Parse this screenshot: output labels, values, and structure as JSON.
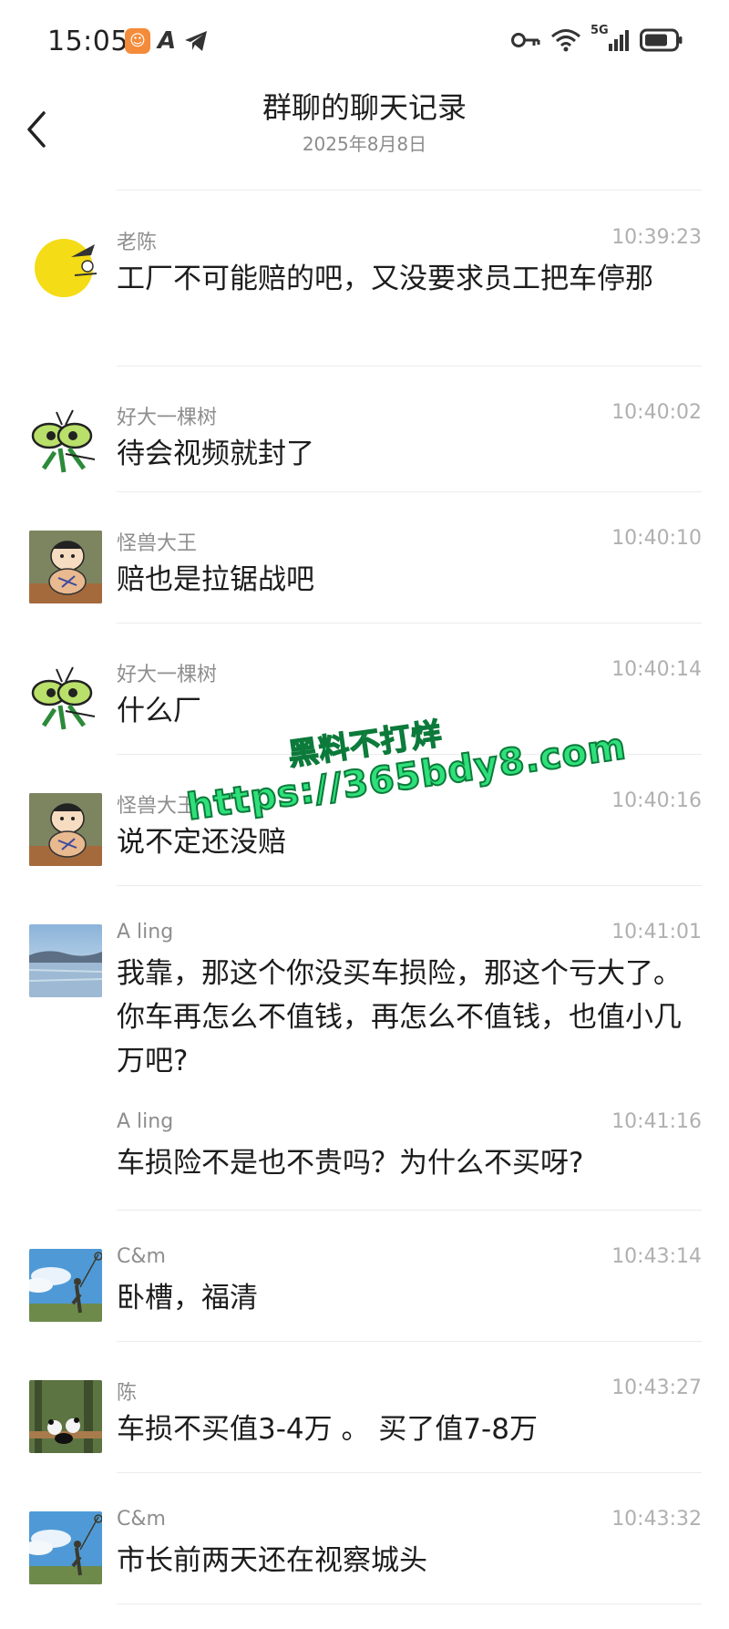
{
  "status_bar": {
    "time": "15:05",
    "network": "5G",
    "icons": [
      "app-badge-icon",
      "font-a-icon",
      "telegram-icon",
      "key-icon",
      "wifi-icon",
      "signal-icon",
      "battery-icon"
    ]
  },
  "header": {
    "title": "群聊的聊天记录",
    "subtitle": "2025年8月8日"
  },
  "messages": [
    {
      "sender": "老陈",
      "time": "10:39:23",
      "text": "工厂不可能赔的吧，又没要求员工把车停那",
      "avatar": "moon-avatar"
    },
    {
      "sender": "好大一棵树",
      "time": "10:40:02",
      "text": "待会视频就封了",
      "avatar": "mantis-avatar"
    },
    {
      "sender": "怪兽大王",
      "time": "10:40:10",
      "text": "赔也是拉锯战吧",
      "avatar": "cartoon-boy-avatar"
    },
    {
      "sender": "好大一棵树",
      "time": "10:40:14",
      "text": "什么厂",
      "avatar": "mantis-avatar"
    },
    {
      "sender": "怪兽大王",
      "time": "10:40:16",
      "text": "说不定还没赔",
      "avatar": "cartoon-boy-avatar"
    },
    {
      "sender": "A ling",
      "time": "10:41:01",
      "text": "我靠，那这个你没买车损险，那这个亏大了。你车再怎么不值钱，再怎么不值钱，也值小几万吧?",
      "avatar": "lake-avatar"
    },
    {
      "sender": "A ling",
      "time": "10:41:16",
      "text": "车损险不是也不贵吗？为什么不买呀?",
      "avatar": ""
    },
    {
      "sender": "C&m",
      "time": "10:43:14",
      "text": "卧槽，福清",
      "avatar": "sky-fishing-avatar"
    },
    {
      "sender": "陈",
      "time": "10:43:27",
      "text": "车损不买值3-4万 。 买了值7-8万",
      "avatar": "pandas-avatar"
    },
    {
      "sender": "C&m",
      "time": "10:43:32",
      "text": "市长前两天还在视察城头",
      "avatar": "sky-fishing-avatar"
    }
  ],
  "watermark": {
    "line1": "黑料不打烊",
    "line2": "https://365bdy8.com",
    "color": "#2ee07a"
  }
}
